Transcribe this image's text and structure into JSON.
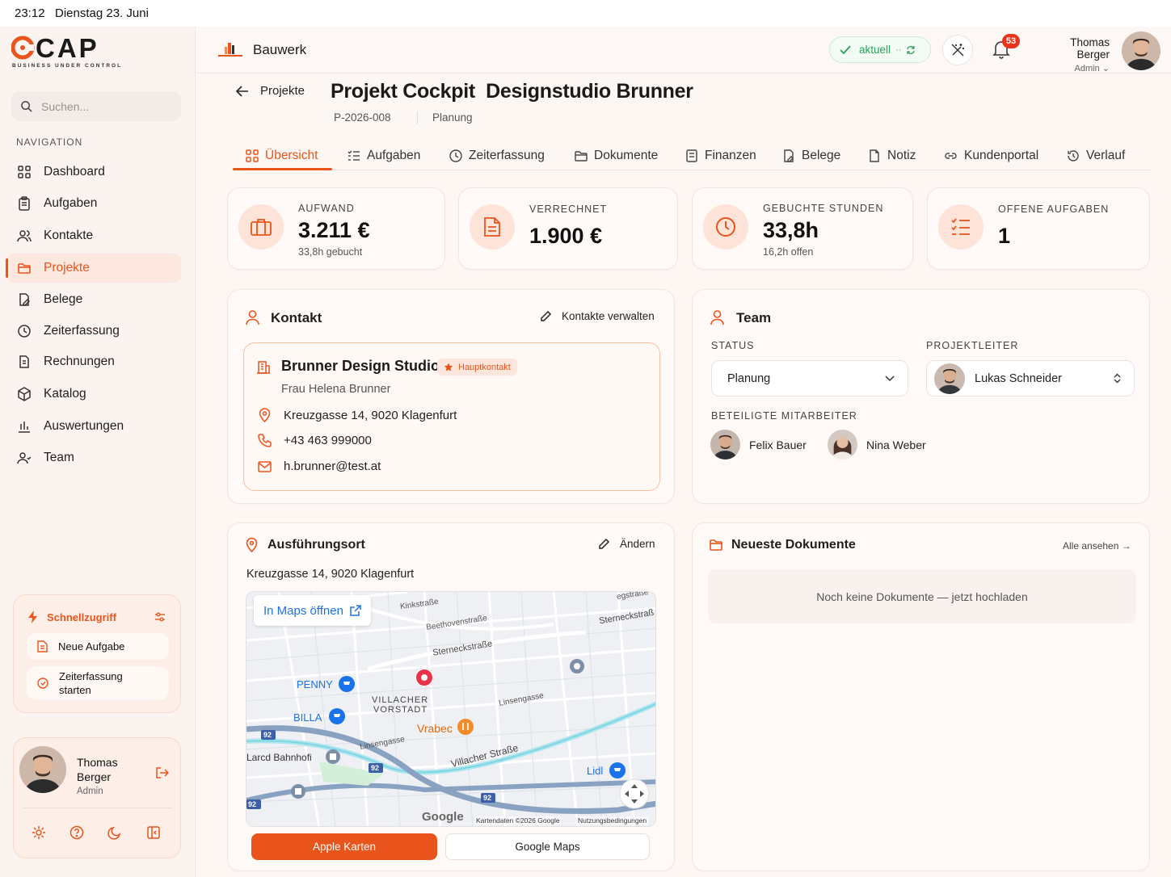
{
  "status_bar": {
    "time": "23:12",
    "date": "Dienstag 23. Juni"
  },
  "brand": {
    "logo_text": "CAP",
    "tagline": "BUSINESS UNDER CONTROL",
    "accent": "#e8541c"
  },
  "sidebar": {
    "search_placeholder": "Suchen...",
    "nav_heading": "NAVIGATION",
    "items": [
      {
        "label": "Dashboard",
        "icon": "grid-icon"
      },
      {
        "label": "Aufgaben",
        "icon": "clipboard-icon"
      },
      {
        "label": "Kontakte",
        "icon": "users-icon"
      },
      {
        "label": "Projekte",
        "icon": "folder-icon",
        "active": true
      },
      {
        "label": "Belege",
        "icon": "receipt-icon"
      },
      {
        "label": "Zeiterfassung",
        "icon": "clock-icon"
      },
      {
        "label": "Rechnungen",
        "icon": "invoice-icon"
      },
      {
        "label": "Katalog",
        "icon": "box-icon"
      },
      {
        "label": "Auswertungen",
        "icon": "bar-chart-icon"
      },
      {
        "label": "Team",
        "icon": "team-icon"
      }
    ],
    "quick_access": {
      "title": "Schnellzugriff",
      "items": [
        {
          "label": "Neue Aufgabe"
        },
        {
          "label_line1": "Zeiterfassung",
          "label_line2": "starten"
        }
      ]
    },
    "user": {
      "first": "Thomas",
      "last": "Berger",
      "role": "Admin"
    }
  },
  "header": {
    "company": "Bauwerk",
    "sync_status": "aktuell",
    "notification_count": "53",
    "user_name": "Thomas Berger",
    "user_role": "Admin"
  },
  "project": {
    "back_label": "Projekte",
    "title": "Projekt Cockpit  Designstudio Brunner",
    "number": "P-2026-008",
    "phase": "Planung",
    "tabs": [
      "Übersicht",
      "Aufgaben",
      "Zeiterfassung",
      "Dokumente",
      "Finanzen",
      "Belege",
      "Notiz",
      "Kundenportal",
      "Verlauf"
    ],
    "active_tab": "Übersicht"
  },
  "kpis": [
    {
      "label": "AUFWAND",
      "value": "3.211 €",
      "sub": "33,8h gebucht"
    },
    {
      "label": "VERRECHNET",
      "value": "1.900 €",
      "sub": ""
    },
    {
      "label": "GEBUCHTE STUNDEN",
      "value": "33,8h",
      "sub": "16,2h offen"
    },
    {
      "label": "OFFENE AUFGABEN",
      "value": "1",
      "sub": ""
    }
  ],
  "contact": {
    "section_title": "Kontakt",
    "manage_label": "Kontakte verwalten",
    "company": "Brunner Design Studio",
    "badge": "Hauptkontakt",
    "person": "Frau Helena Brunner",
    "address": "Kreuzgasse 14, 9020 Klagenfurt",
    "phone": "+43 463 999000",
    "email": "h.brunner@test.at"
  },
  "team": {
    "section_title": "Team",
    "status_label": "STATUS",
    "status_value": "Planung",
    "lead_label": "PROJEKTLEITER",
    "lead_value": "Lukas Schneider",
    "members_label": "BETEILIGTE MITARBEITER",
    "members": [
      "Felix Bauer",
      "Nina Weber"
    ]
  },
  "location": {
    "section_title": "Ausführungsort",
    "edit_label": "Ändern",
    "address": "Kreuzgasse 14, 9020 Klagenfurt",
    "open_maps": "In Maps öffnen",
    "map_labels": {
      "kinkstrasse": "Kinkstraße",
      "beethoven": "Beethovenstraße",
      "sterneck": "Sterneckstraße",
      "sterneck2": "Sterneckstraß",
      "egstrasse": "egstraße",
      "penny": "PENNY",
      "billa": "BILLA",
      "villacher_vorstadt_1": "VILLACHER",
      "villacher_vorstadt_2": "VORSTADT",
      "linsengasse": "Linsengasse",
      "linsengasse2": "Linsengasse",
      "vrabec": "Vrabec",
      "villacher_strasse": "Villacher Straße",
      "bahnhof": "Larcd Bahnhofi",
      "lidl": "Lidl",
      "route92": "92",
      "google": "Google",
      "copyright": "Kartendaten ©2026 Google",
      "terms": "Nutzungsbedingungen"
    },
    "apple_btn": "Apple Karten",
    "google_btn": "Google Maps"
  },
  "documents": {
    "section_title": "Neueste Dokumente",
    "see_all": "Alle ansehen →",
    "empty": "Noch keine Dokumente — jetzt hochladen"
  }
}
